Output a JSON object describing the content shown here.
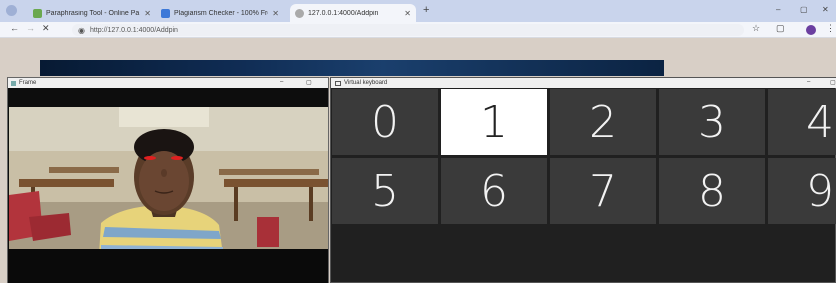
{
  "browser": {
    "tabs": [
      {
        "label": "Paraphrasing Tool - Online Pa",
        "active": false,
        "color": "#6aa84f"
      },
      {
        "label": "Plagiarism Checker - 100% Fre",
        "active": false,
        "color": "#3c78d8"
      },
      {
        "label": "127.0.0.1:4000/Addpin",
        "active": true,
        "color": "#999999"
      }
    ],
    "new_tab": "+",
    "url": "http://127.0.0.1:4000/Addpin",
    "min": "–",
    "max": "▢",
    "close": "✕"
  },
  "frame_window": {
    "title": "Frame",
    "min": "–",
    "max": "▢"
  },
  "keyboard_window": {
    "title": "Virtual keyboard",
    "min": "–",
    "max": "▢",
    "keys": [
      "0",
      "1",
      "2",
      "3",
      "4",
      "5",
      "6",
      "7",
      "8",
      "9"
    ],
    "selected_key": "1"
  },
  "colors": {
    "accent": "#3c78d8",
    "pupil_marker": "#e02020"
  }
}
